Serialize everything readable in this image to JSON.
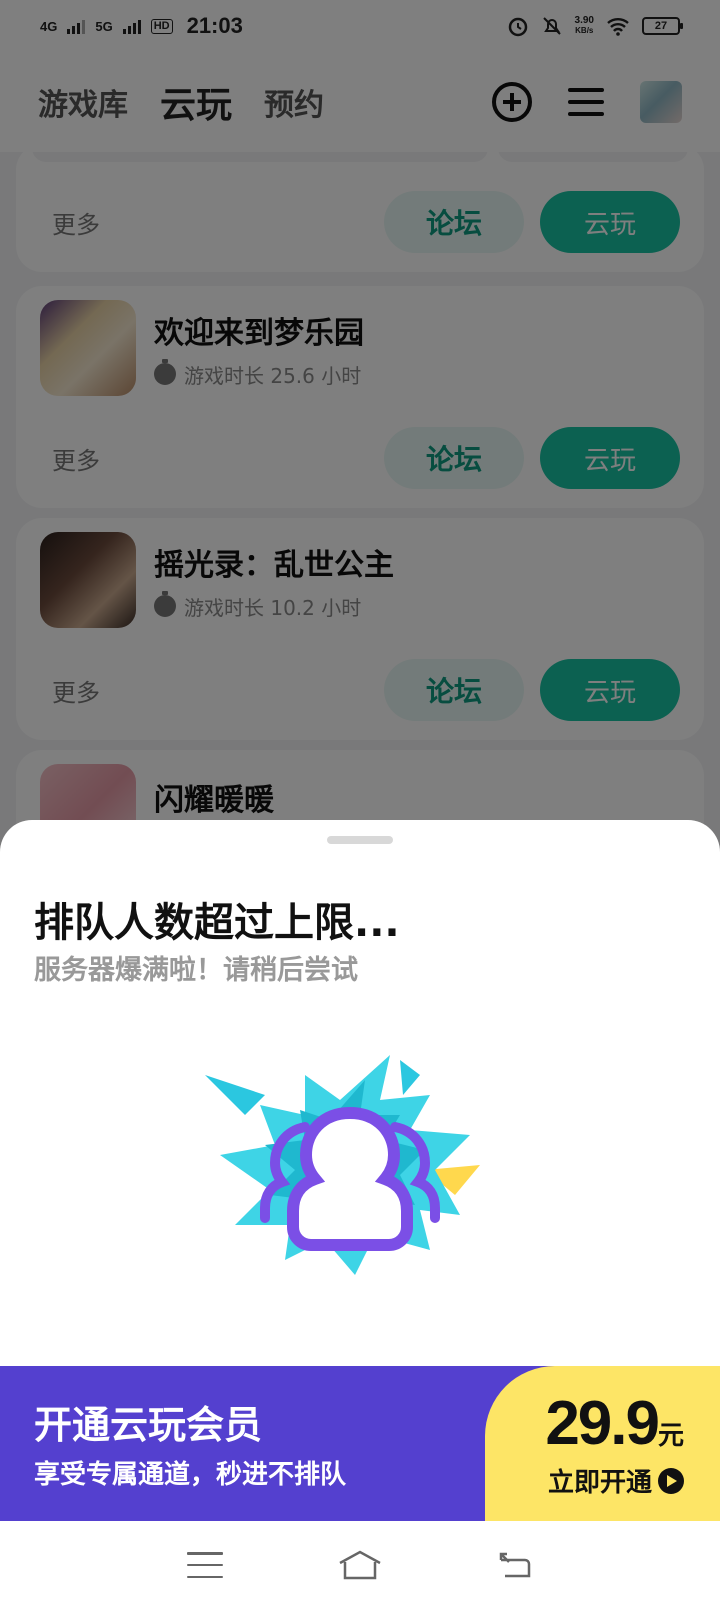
{
  "status_bar": {
    "net1": "4G",
    "net2": "5G",
    "hd": "HD",
    "time": "21:03",
    "speed_value": "3.90",
    "speed_unit": "KB/s",
    "battery": "27"
  },
  "header": {
    "tabs": [
      {
        "label": "游戏库",
        "active": false
      },
      {
        "label": "云玩",
        "active": true
      },
      {
        "label": "预约",
        "active": false
      }
    ]
  },
  "games": [
    {
      "title": "",
      "time": "",
      "more": "更多",
      "forum": "论坛",
      "cloud": "云玩"
    },
    {
      "title": "欢迎来到梦乐园",
      "time": "游戏时长 25.6 小时",
      "more": "更多",
      "forum": "论坛",
      "cloud": "云玩"
    },
    {
      "title": "摇光录：乱世公主",
      "time": "游戏时长 10.2 小时",
      "more": "更多",
      "forum": "论坛",
      "cloud": "云玩"
    },
    {
      "title": "闪耀暖暖",
      "time": "",
      "more": "",
      "forum": "",
      "cloud": ""
    }
  ],
  "sheet": {
    "title": "排队人数超过上限...",
    "subtitle": "服务器爆满啦！请稍后尝试",
    "vip_title": "开通云玩会员",
    "vip_subtitle": "享受专属通道，秒进不排队",
    "price": "29.9",
    "price_unit": "元",
    "cta": "立即开通"
  },
  "colors": {
    "accent": "#19c3a3",
    "vip_purple": "#5440cf",
    "vip_yellow": "#fde566"
  }
}
